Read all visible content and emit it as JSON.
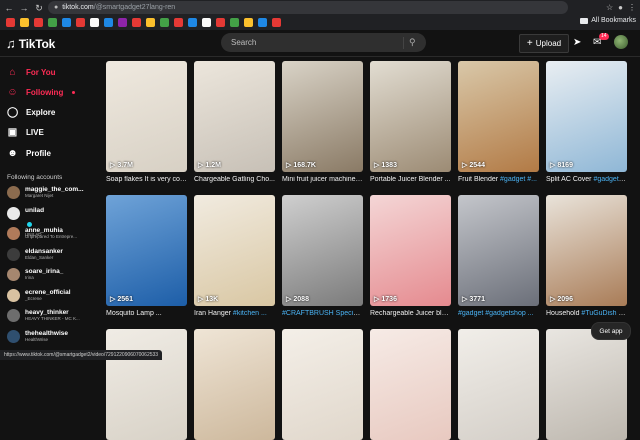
{
  "browser": {
    "url_host": "tiktok.com",
    "url_path": "/@smartgadget27lang-ren",
    "bookmarks_label": "All Bookmarks",
    "status_url": "https://www.tiktok.com/@smartgadget2/video/7291220906070062533"
  },
  "header": {
    "logo_text": "TikTok",
    "search_placeholder": "Search",
    "upload_label": "Upload",
    "inbox_badge": "14"
  },
  "sidebar": {
    "nav": [
      {
        "label": "For You",
        "icon": "home-icon"
      },
      {
        "label": "Following",
        "icon": "following-icon"
      },
      {
        "label": "Explore",
        "icon": "compass-icon"
      },
      {
        "label": "LIVE",
        "icon": "live-icon"
      },
      {
        "label": "Profile",
        "icon": "user-icon"
      }
    ],
    "following_title": "Following accounts",
    "accounts": [
      {
        "username": "maggie_the_com...",
        "name": "Margaret Nijet",
        "color": "#8b6b4e"
      },
      {
        "username": "unilad",
        "name": "UNILAD",
        "color": "#e9e9e9",
        "verified": true
      },
      {
        "username": "anne_muhia",
        "name": "Unprepared To Entrepre...",
        "color": "#b07a5a"
      },
      {
        "username": "eldansanker",
        "name": "Eldan_Sanker",
        "color": "#3c3c3c"
      },
      {
        "username": "soare_irina_",
        "name": "Irina",
        "color": "#a6876f"
      },
      {
        "username": "ecrene_official",
        "name": "_Ecrene",
        "color": "#d9c2a1"
      },
      {
        "username": "heavy_thinker",
        "name": "HEAVY THINKER - MC K...",
        "color": "#6d6d6d"
      },
      {
        "username": "thehealthwise",
        "name": "HealthWise",
        "color": "#2f4f6f"
      }
    ]
  },
  "videos": [
    {
      "views": "3.7M",
      "caption": "Soap flakes It is very con...",
      "c1": "#d7d0c4",
      "c2": "#efe9df"
    },
    {
      "views": "1.2M",
      "caption": "Chargeable Gatling Cho...",
      "c1": "#c7c0b6",
      "c2": "#ece6dc"
    },
    {
      "views": "168.7K",
      "caption": "Mini fruit juicer machine ...",
      "c1": "#8a7a65",
      "c2": "#d9d3c7"
    },
    {
      "views": "1383",
      "caption": "Portable Juicer Blender ...",
      "c1": "#9c8b74",
      "c2": "#e2ddd2"
    },
    {
      "views": "2544",
      "caption": "Fruit Blender ",
      "tags": "#gadget #...",
      "c1": "#b27a45",
      "c2": "#d9c8a9"
    },
    {
      "views": "8169",
      "caption": "Split AC Cover ",
      "tags": "#gadget #...",
      "c1": "#8fb7d6",
      "c2": "#e9eef2"
    },
    {
      "views": "2561",
      "caption": "Mosquito Lamp ...",
      "c1": "#1d5ea8",
      "c2": "#6fa3d8"
    },
    {
      "views": "13K",
      "caption": "Iran Hanger ",
      "tags": "#kitchen ...",
      "c1": "#d9c7a3",
      "c2": "#f1ebe0"
    },
    {
      "views": "2088",
      "caption": "",
      "tags": "#CRAFTBRUSH Speciali...",
      "c1": "#7b7b7b",
      "c2": "#cfcfcf"
    },
    {
      "views": "1736",
      "caption": "Rechargeable Juicer ble...",
      "c1": "#e58a8f",
      "c2": "#f4d6d6"
    },
    {
      "views": "3771",
      "caption": "",
      "tags": "#gadget #gadgetshop ...",
      "c1": "#6b6f79",
      "c2": "#c4c6cb"
    },
    {
      "views": "2096",
      "caption": "Household ",
      "tags": "#TuGuDish Fra...",
      "c1": "#a97c57",
      "c2": "#e9e3da"
    },
    {
      "views": "",
      "caption": "",
      "c1": "#d8d2c7",
      "c2": "#f0ece5"
    },
    {
      "views": "",
      "caption": "",
      "c1": "#cdb89c",
      "c2": "#efe5d6"
    },
    {
      "views": "",
      "caption": "",
      "c1": "#e0d7cb",
      "c2": "#f4efe8"
    },
    {
      "views": "",
      "caption": "",
      "c1": "#e8c9c0",
      "c2": "#f6ebe6"
    },
    {
      "views": "",
      "caption": "",
      "c1": "#d4cfc8",
      "c2": "#f1eee9"
    },
    {
      "views": "",
      "caption": "",
      "c1": "#bdb7ae",
      "c2": "#e9e6e1"
    }
  ],
  "get_app_label": "Get app",
  "colors": {
    "accent": "#fe2c55",
    "hashtag": "#4ab3f4",
    "background": "#121212"
  }
}
